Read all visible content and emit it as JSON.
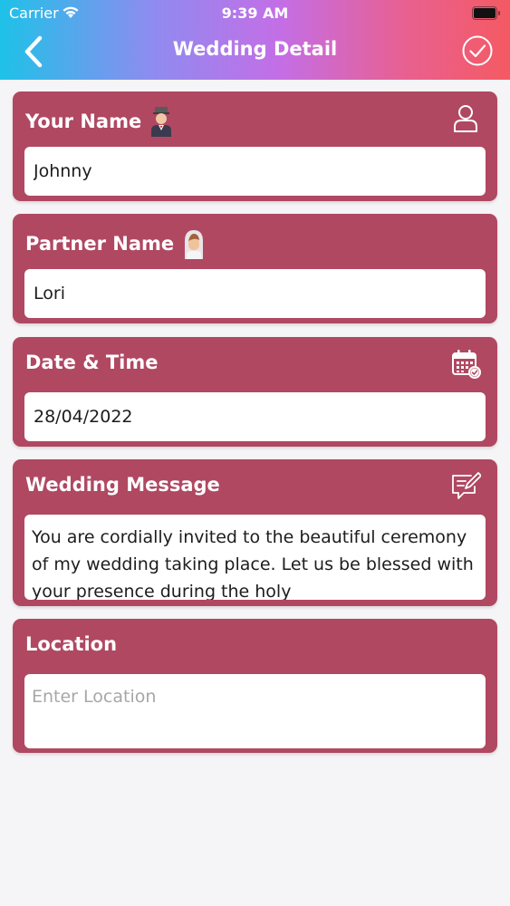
{
  "status_bar": {
    "carrier": "Carrier",
    "time": "9:39 AM"
  },
  "header": {
    "title": "Wedding Detail",
    "back_icon": "chevron-left-icon",
    "done_icon": "checkmark-circle-icon"
  },
  "colors": {
    "card_background": "#b04862",
    "page_background": "#f5f4f6",
    "header_gradient": [
      "#1ec2e8",
      "#c46ee6",
      "#f45a63"
    ]
  },
  "form": {
    "your_name": {
      "label": "Your Name",
      "value": "Johnny",
      "icon": "person-icon",
      "badge_icon": "groom-icon"
    },
    "partner_name": {
      "label": "Partner Name",
      "value": "Lori",
      "badge_icon": "bride-icon"
    },
    "date_time": {
      "label": "Date & Time",
      "value": "28/04/2022",
      "icon": "calendar-check-icon"
    },
    "wedding_message": {
      "label": "Wedding Message",
      "value": "You are cordially invited to the beautiful ceremony of my wedding taking place. Let us be blessed with your presence during the holy",
      "icon": "compose-message-icon"
    },
    "location": {
      "label": "Location",
      "value": "",
      "placeholder": "Enter Location"
    }
  }
}
